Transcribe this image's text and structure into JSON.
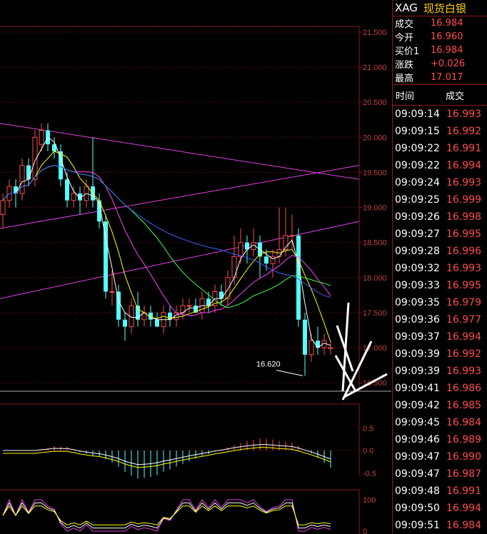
{
  "instrument": {
    "symbol": "XAG",
    "name": "现货白银"
  },
  "quote": [
    {
      "label": "成交",
      "value": "16.984"
    },
    {
      "label": "今开",
      "value": "16.960"
    },
    {
      "label": "买价1",
      "value": "16.984"
    },
    {
      "label": "涨跌",
      "value": "+0.026"
    },
    {
      "label": "最高",
      "value": "17.017"
    }
  ],
  "ticks_header": {
    "time": "时间",
    "price": "成交"
  },
  "ticks": [
    {
      "time": "09:09:14",
      "price": "16.993"
    },
    {
      "time": "09:09:15",
      "price": "16.992"
    },
    {
      "time": "09:09:22",
      "price": "16.991"
    },
    {
      "time": "09:09:22",
      "price": "16.994"
    },
    {
      "time": "09:09:24",
      "price": "16.993"
    },
    {
      "time": "09:09:25",
      "price": "16.999"
    },
    {
      "time": "09:09:26",
      "price": "16.998"
    },
    {
      "time": "09:09:27",
      "price": "16.995"
    },
    {
      "time": "09:09:28",
      "price": "16.996"
    },
    {
      "time": "09:09:32",
      "price": "16.993"
    },
    {
      "time": "09:09:33",
      "price": "16.995"
    },
    {
      "time": "09:09:35",
      "price": "16.979"
    },
    {
      "time": "09:09:36",
      "price": "16.977"
    },
    {
      "time": "09:09:37",
      "price": "16.994"
    },
    {
      "time": "09:09:39",
      "price": "16.992"
    },
    {
      "time": "09:09:39",
      "price": "16.993"
    },
    {
      "time": "09:09:41",
      "price": "16.986"
    },
    {
      "time": "09:09:42",
      "price": "16.985"
    },
    {
      "time": "09:09:45",
      "price": "16.984"
    },
    {
      "time": "09:09:46",
      "price": "16.989"
    },
    {
      "time": "09:09:47",
      "price": "16.990"
    },
    {
      "time": "09:09:47",
      "price": "16.987"
    },
    {
      "time": "09:09:48",
      "price": "16.991"
    },
    {
      "time": "09:09:50",
      "price": "16.994"
    },
    {
      "time": "09:09:51",
      "price": "16.984"
    }
  ],
  "chart_data": {
    "type": "candlestick",
    "price_axis": {
      "min": 16.4,
      "max": 21.5,
      "ticks": [
        "21.500",
        "21.000",
        "20.500",
        "20.000",
        "19.500",
        "19.000",
        "18.500",
        "18.000",
        "17.500",
        "17.000",
        "16.500"
      ]
    },
    "low_label": "16.620",
    "candles": [
      [
        18.9,
        19.1,
        18.7,
        19.2
      ],
      [
        19.1,
        19.3,
        19.0,
        19.4
      ],
      [
        19.3,
        19.2,
        19.0,
        19.4
      ],
      [
        19.2,
        19.6,
        19.1,
        19.7
      ],
      [
        19.6,
        19.4,
        19.3,
        19.7
      ],
      [
        19.4,
        20.0,
        19.3,
        20.1
      ],
      [
        19.9,
        20.1,
        19.8,
        20.2
      ],
      [
        20.1,
        19.9,
        19.8,
        20.2
      ],
      [
        19.9,
        19.8,
        19.7,
        20.0
      ],
      [
        19.8,
        19.4,
        19.3,
        19.9
      ],
      [
        19.4,
        19.1,
        19.0,
        19.5
      ],
      [
        19.1,
        19.2,
        19.0,
        19.3
      ],
      [
        19.2,
        19.1,
        18.9,
        19.3
      ],
      [
        19.1,
        19.3,
        19.0,
        19.4
      ],
      [
        19.3,
        19.1,
        19.0,
        20.0
      ],
      [
        19.1,
        18.8,
        18.7,
        19.2
      ],
      [
        18.8,
        17.8,
        17.7,
        18.9
      ],
      [
        17.8,
        17.8,
        17.6,
        18.1
      ],
      [
        17.8,
        17.4,
        17.3,
        17.9
      ],
      [
        17.4,
        17.3,
        17.1,
        17.5
      ],
      [
        17.3,
        17.6,
        17.2,
        17.7
      ],
      [
        17.6,
        17.4,
        17.3,
        17.8
      ],
      [
        17.4,
        17.5,
        17.3,
        17.6
      ],
      [
        17.5,
        17.4,
        17.3,
        17.6
      ],
      [
        17.4,
        17.3,
        17.3,
        17.5
      ],
      [
        17.3,
        17.5,
        17.2,
        17.6
      ],
      [
        17.5,
        17.4,
        17.3,
        17.6
      ],
      [
        17.4,
        17.5,
        17.3,
        17.6
      ],
      [
        17.5,
        17.6,
        17.4,
        17.7
      ],
      [
        17.6,
        17.6,
        17.5,
        17.7
      ],
      [
        17.6,
        17.5,
        17.5,
        17.7
      ],
      [
        17.5,
        17.7,
        17.4,
        17.8
      ],
      [
        17.7,
        17.6,
        17.5,
        17.8
      ],
      [
        17.6,
        17.8,
        17.5,
        17.9
      ],
      [
        17.8,
        17.7,
        17.6,
        17.9
      ],
      [
        17.7,
        18.0,
        17.6,
        18.1
      ],
      [
        18.0,
        18.3,
        17.9,
        18.6
      ],
      [
        18.3,
        18.5,
        18.2,
        18.7
      ],
      [
        18.5,
        18.4,
        18.2,
        18.6
      ],
      [
        18.4,
        18.5,
        18.3,
        18.7
      ],
      [
        18.5,
        18.3,
        18.0,
        18.6
      ],
      [
        18.3,
        18.2,
        18.1,
        18.4
      ],
      [
        18.2,
        18.3,
        18.0,
        18.4
      ],
      [
        18.3,
        18.4,
        18.2,
        19.0
      ],
      [
        18.4,
        18.6,
        18.3,
        19.0
      ],
      [
        18.6,
        18.6,
        18.4,
        18.9
      ],
      [
        18.6,
        17.4,
        17.3,
        18.7
      ],
      [
        17.4,
        16.9,
        16.6,
        17.5
      ],
      [
        16.9,
        17.1,
        16.8,
        17.2
      ],
      [
        17.1,
        17.0,
        16.9,
        17.3
      ],
      [
        17.0,
        17.1,
        16.9,
        17.2
      ],
      [
        17.0,
        17.0,
        16.9,
        17.1
      ]
    ],
    "macd_axis": [
      "0.5",
      "0.0",
      "-0.5"
    ],
    "kdj_axis": [
      "100",
      "0"
    ]
  },
  "colors": {
    "up": "#ff4b4b",
    "down": "#54ffff",
    "grid": "#8b1a1a",
    "axis_text": "#c04040"
  }
}
